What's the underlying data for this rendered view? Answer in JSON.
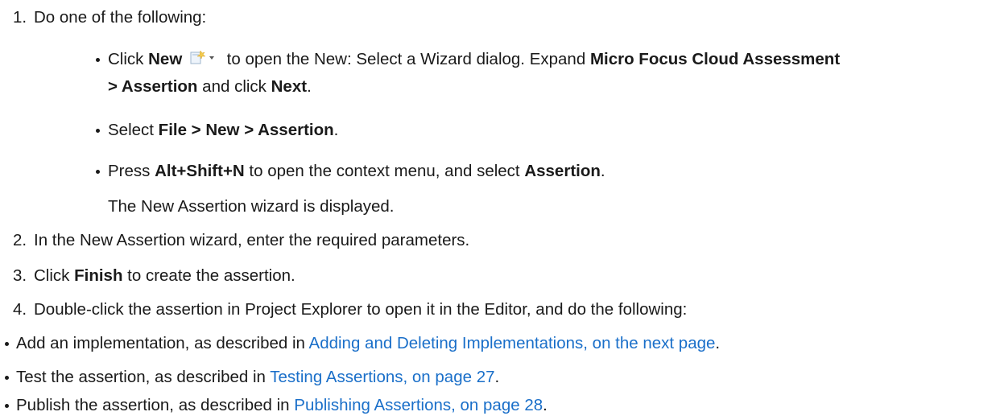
{
  "steps": {
    "s1": {
      "num": "1.",
      "text": "Do one of the following:"
    },
    "b1": {
      "t1": "Click ",
      "new": "New",
      "t2": " to open the New: Select a Wizard dialog. Expand ",
      "mfca": "Micro Focus Cloud Assessment",
      "assertion": "> Assertion",
      "t3": " and click ",
      "next": "Next",
      "t4": "."
    },
    "b2": {
      "t1": "Select ",
      "path": "File > New > Assertion",
      "t2": "."
    },
    "b3": {
      "t1": "Press ",
      "keys": "Alt+Shift+N",
      "t2": " to open the context menu, and select ",
      "assertion": "Assertion",
      "t3": ".",
      "note": "The New Assertion wizard is displayed."
    },
    "s2": {
      "num": "2.",
      "text": "In the New Assertion wizard, enter the required parameters."
    },
    "s3": {
      "num": "3.",
      "t1": "Click ",
      "finish": "Finish",
      "t2": " to create the assertion."
    },
    "s4": {
      "num": "4.",
      "text": "Double-click the assertion in Project Explorer to open it in the Editor, and do the following:"
    }
  },
  "subitems": {
    "i1": {
      "t1": "Add an implementation, as described in ",
      "link": "Adding and Deleting Implementations, on the next page",
      "t2": "."
    },
    "i2": {
      "t1": "Test the assertion, as described in ",
      "link": "Testing Assertions, on page 27",
      "t2": "."
    },
    "i3": {
      "t1": "Publish the assertion, as described in ",
      "link": "Publishing Assertions, on page 28",
      "t2": "."
    }
  },
  "icons": {
    "new_button": "new-wizard-icon"
  },
  "colors": {
    "text": "#1a1a1a",
    "link": "#1a6fc9"
  }
}
